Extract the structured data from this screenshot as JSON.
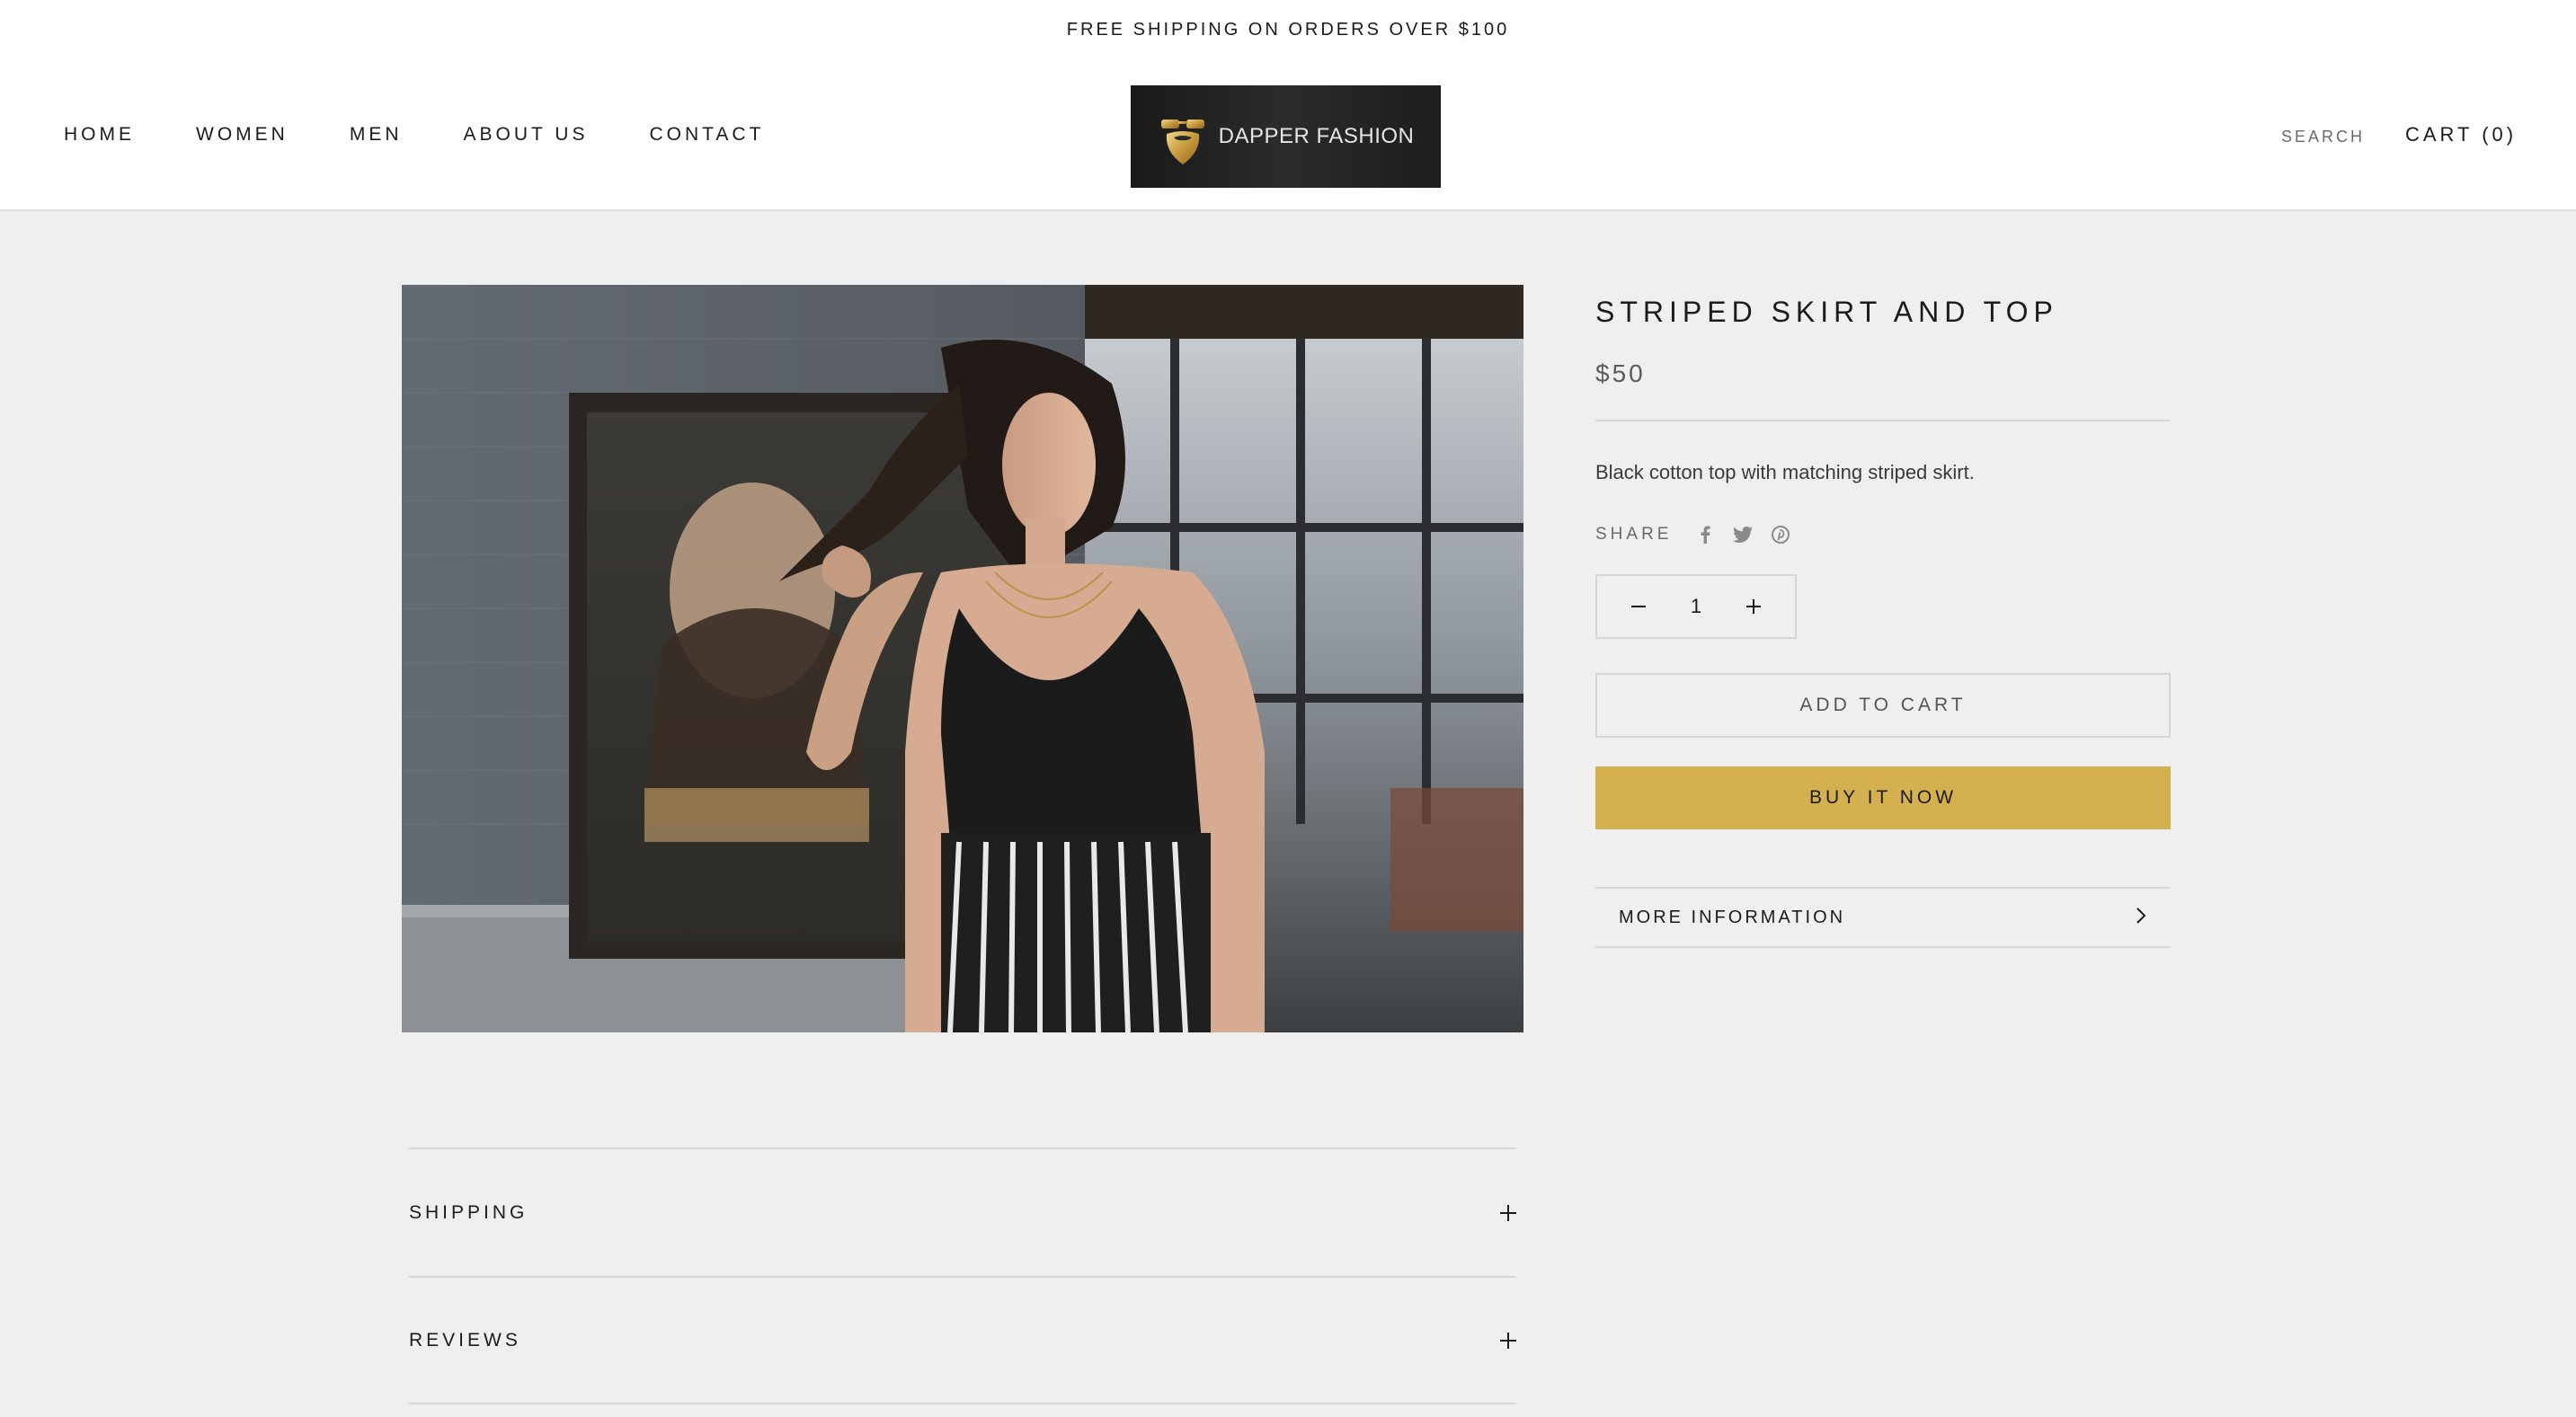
{
  "announcement": "FREE SHIPPING ON ORDERS OVER $100",
  "nav": {
    "items": [
      {
        "label": "HOME"
      },
      {
        "label": "WOMEN"
      },
      {
        "label": "MEN"
      },
      {
        "label": "ABOUT US"
      },
      {
        "label": "CONTACT"
      }
    ]
  },
  "logo": {
    "text": "DAPPER FASHION"
  },
  "header": {
    "search_label": "SEARCH",
    "cart_label": "CART (0)"
  },
  "product": {
    "title": "STRIPED SKIRT AND TOP",
    "price": "$50",
    "description": "Black cotton top with matching striped skirt.",
    "share_label": "SHARE",
    "share_icons": [
      "facebook-icon",
      "twitter-icon",
      "pinterest-icon"
    ],
    "quantity": "1",
    "add_to_cart_label": "ADD TO CART",
    "buy_now_label": "BUY IT NOW",
    "more_info_label": "MORE INFORMATION"
  },
  "accordion": {
    "items": [
      {
        "label": "SHIPPING"
      },
      {
        "label": "REVIEWS"
      }
    ]
  },
  "colors": {
    "accent": "#d4b04f",
    "background": "#efefef",
    "text": "#1c1b1b"
  }
}
